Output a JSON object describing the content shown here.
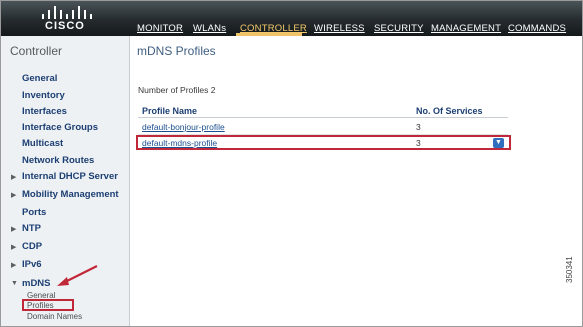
{
  "brand": {
    "name": "CISCO"
  },
  "nav": [
    {
      "label": "MONITOR",
      "active": false
    },
    {
      "label": "WLANs",
      "active": false
    },
    {
      "label": "CONTROLLER",
      "active": true
    },
    {
      "label": "WIRELESS",
      "active": false
    },
    {
      "label": "SECURITY",
      "active": false
    },
    {
      "label": "MANAGEMENT",
      "active": false
    },
    {
      "label": "COMMANDS",
      "active": false
    }
  ],
  "sidebar": {
    "title": "Controller",
    "items": [
      {
        "label": "General",
        "expandable": false
      },
      {
        "label": "Inventory",
        "expandable": false
      },
      {
        "label": "Interfaces",
        "expandable": false
      },
      {
        "label": "Interface Groups",
        "expandable": false
      },
      {
        "label": "Multicast",
        "expandable": false
      },
      {
        "label": "Network Routes",
        "expandable": false
      },
      {
        "label": "Internal DHCP Server",
        "expandable": true
      },
      {
        "label": "Mobility Management",
        "expandable": true
      },
      {
        "label": "Ports",
        "expandable": false
      },
      {
        "label": "NTP",
        "expandable": true
      },
      {
        "label": "CDP",
        "expandable": true
      },
      {
        "label": "IPv6",
        "expandable": true
      },
      {
        "label": "mDNS",
        "expandable": true,
        "expanded": true
      }
    ],
    "mdns_subitems": [
      "General",
      "Profiles",
      "Domain Names"
    ],
    "active_subitem": "Profiles"
  },
  "main": {
    "title": "mDNS Profiles",
    "count_label": "Number of Profiles",
    "count_value": "2",
    "columns": [
      "Profile Name",
      "No. Of Services"
    ],
    "rows": [
      {
        "name": "default-bonjour-profile",
        "services": "3"
      },
      {
        "name": "default-mdns-profile",
        "services": "3",
        "highlighted": true
      }
    ]
  },
  "figure_id": "350341",
  "colors": {
    "accent": "#c0283a",
    "link": "#1c4f8f",
    "nav_active": "#f5c96a"
  }
}
